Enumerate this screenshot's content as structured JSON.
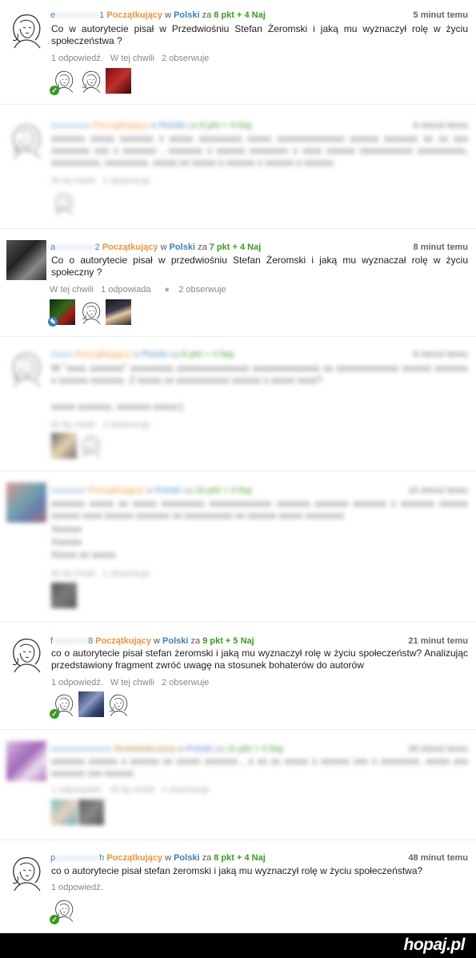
{
  "questions": [
    {
      "user_prefix": "e",
      "user_masked": "xxxxxxxxxx",
      "user_suffix": "1",
      "level": "Początkujący",
      "in_word": "w",
      "subject": "Polski",
      "za_word": "za",
      "points": "8 pkt + 4 Naj",
      "time": "5 minut temu",
      "text": "Co w autorytecie pisał w Przedwiośniu Stefan Żeromski i jaką mu wyznaczył rolę w życiu społeczeństwa ?",
      "meta": [
        "1 odpowiedź.",
        "W tej chwili",
        "2 obserwuje"
      ]
    },
    {
      "user_masked": "xxxxxxxxx",
      "level": "Początkujący",
      "in_word": "w",
      "subject": "Polski",
      "za_word": "za",
      "points": "8 pkt + 4 Naj",
      "time": "6 minut temu",
      "text": "xxxxxxx xxxxx xxxxxxx x xxxxx xxxxxxxxx xxxxx xxxxxxxxxxxxxx xxxxxx xxxxxxx xx xx xxx xxxxxxxx xxx x xxxxxxx , xxxxxxx x xxxxxx xxxxxxxx x xxxx xxxxxx xxxxxxxxxxx xxxxxxxxxx, xxxxxxxxxx, xxxxxxxxx. xxxxx xx xxxxx x xxxxxx x xxxxxx x xxxxxx.",
      "meta": [
        "W tej chwili",
        "1 obserwuje"
      ]
    },
    {
      "user_prefix": "a",
      "user_masked": "xxxxxxxxx",
      "user_suffix": "2",
      "level": "Początkujący",
      "in_word": "w",
      "subject": "Polski",
      "za_word": "za",
      "points": "7 pkt + 4 Naj",
      "time": "8 minut temu",
      "text": "Co o autorytecie pisał w przedwiośniu Stefan Żeromski i jaką mu wyznaczał rolę w życiu społeczny ?",
      "meta": [
        "W tej chwili",
        "1 odpowiada",
        "2 obserwuje"
      ]
    },
    {
      "user_masked": "xxxxx",
      "level": "Początkujący",
      "in_word": "w",
      "subject": "Polski",
      "za_word": "za",
      "points": "8 pkt + 4 Naj",
      "time": "8 minut temu",
      "text": "W \"xxxx xxxxxxx\" xxxxxxxxx xxxxxxxxxxxxxxx xxxxxxxxxxxxxx xx xxxxxxxxxxxxx xxxxxx xxxxxxx x xxxxxx xxxxxxx. Z xxxxx xx xxxxxxxxxxx xxxxxx x xxxxx xxxx?",
      "text2": "xxxxx xxxxxxx. xxxxxxx xxxxx:)",
      "meta": [
        "W tej chwili",
        "2 obserwuje"
      ]
    },
    {
      "user_masked": "xxxxxxxx",
      "level": "Początkujący",
      "in_word": "w",
      "subject": "Polski",
      "za_word": "za",
      "points": "10 pkt + 4 Naj",
      "time": "10 minut temu",
      "text": "xxxxxxx xxxxx xx xxxxx xxxxxxxxx xxxxxxxxxxxxx xxxxxxx xxxxxxx xxxxxxx x xxxxxxx xxxxxx xxxxxx xxxx xxxxxx xxxxxxx xx xxxxxxxxxx xx xxxxxx xxxxx xxxxxxxx",
      "lines": [
        "Xxxxxx",
        "Xxxxxx",
        "Xxxxx xx xxxxx"
      ],
      "meta": [
        "W tej chwili",
        "1 obserwuje"
      ]
    },
    {
      "user_prefix": "f",
      "user_masked": "xxxxxxxx",
      "user_suffix": "8",
      "level": "Początkujący",
      "in_word": "w",
      "subject": "Polski",
      "za_word": "za",
      "points": "9 pkt + 5 Naj",
      "time": "21 minut temu",
      "text": "co o autorytecie pisał stefan żeromski i jaką mu wyznaczył rolę w życiu społeczeństw? Analizując przedstawiony fragment zwróć uwagę na stosunek bohaterów do autorów",
      "meta": [
        "1 odpowiedź.",
        "W tej chwili",
        "2 obserwuje"
      ]
    },
    {
      "user_masked": "xxxxxxxxxxxxxx",
      "level": "Doświadczony",
      "in_word": "w",
      "subject": "Polski",
      "za_word": "za",
      "points": "11 pkt + 4 Naj",
      "time": "28 minut temu",
      "text": "xxxxxxx xxxxxx x xxxxxx xx xxxxx xxxxxxx , x xx xx xxxxx x xxxxxx xxx x xxxxxxxx, xxxxx xxx xxxxxxx xxx xxxxxx.",
      "meta": [
        "1 odpowiedź.",
        "W tej chwili",
        "1 obserwuje"
      ]
    },
    {
      "user_prefix": "p",
      "user_masked": "xxxxxxxxxx",
      "user_suffix": "h",
      "level": "Początkujący",
      "in_word": "w",
      "subject": "Polski",
      "za_word": "za",
      "points": "8 pkt + 4 Naj",
      "time": "48 minut temu",
      "text": "co o autorytecie pisał stefan żeromski i jaką mu wyznaczył rolę w życiu społeczeństwa?",
      "meta": [
        "1 odpowiedź."
      ]
    }
  ],
  "footer": {
    "logo": "hopaj.pl"
  },
  "icons": {
    "check": "check-icon",
    "pencil": "pencil-icon"
  }
}
